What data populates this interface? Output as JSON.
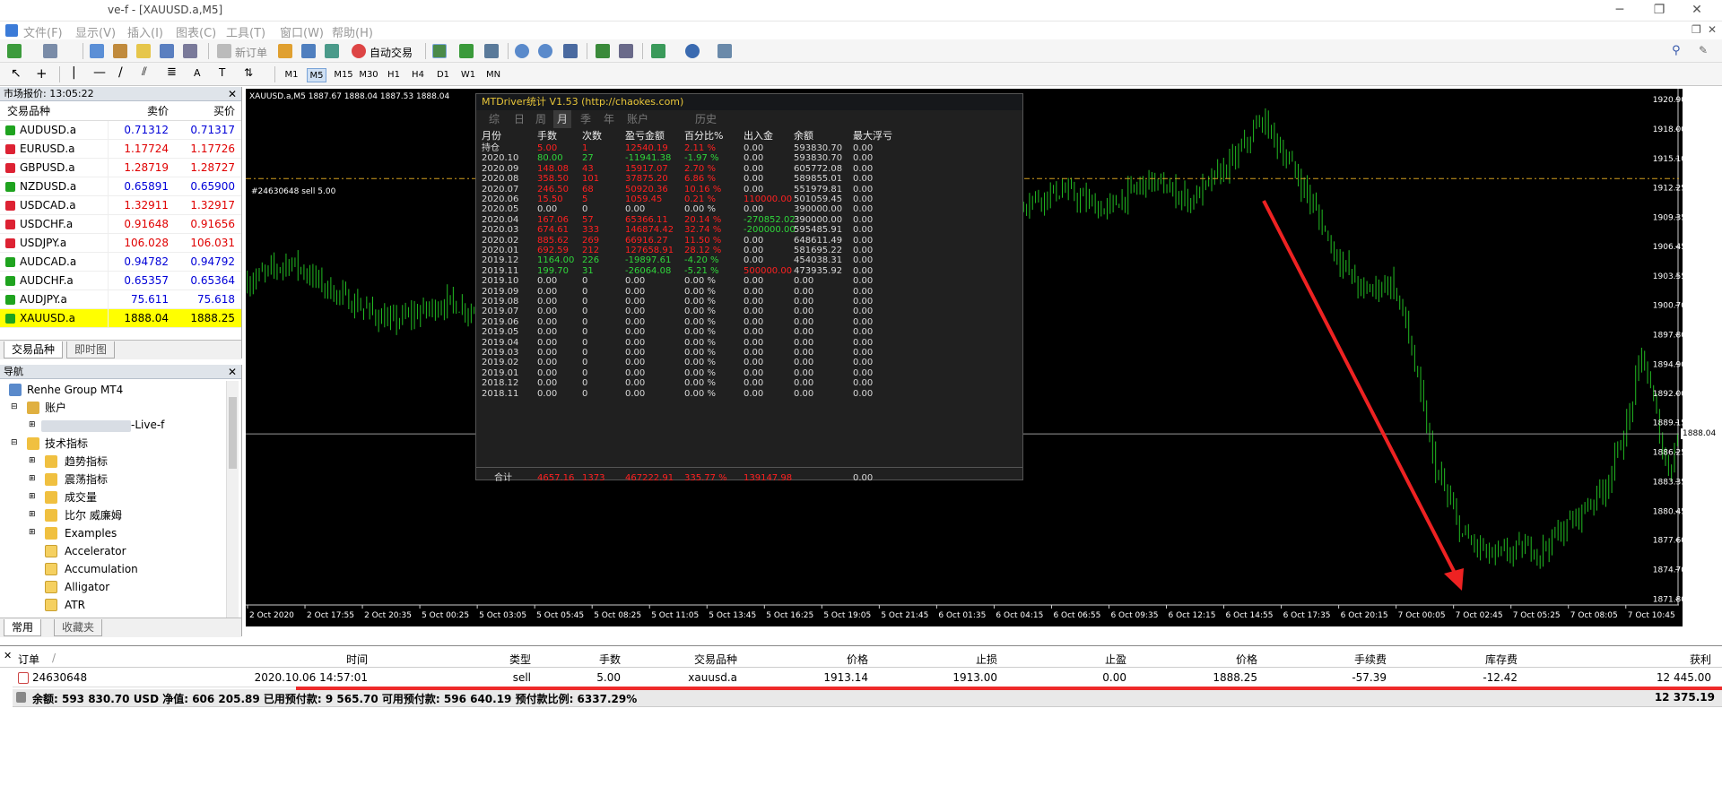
{
  "window": {
    "title": "ve-f - [XAUUSD.a,M5]"
  },
  "menu": [
    "文件(F)",
    "显示(V)",
    "插入(I)",
    "图表(C)",
    "工具(T)",
    "窗口(W)",
    "帮助(H)"
  ],
  "toolbar": {
    "new_order": "新订单",
    "auto_trade": "自动交易",
    "timeframes": [
      "M1",
      "M5",
      "M15",
      "M30",
      "H1",
      "H4",
      "D1",
      "W1",
      "MN"
    ],
    "active_tf": "M5"
  },
  "market_watch": {
    "title": "市场报价: 13:05:22",
    "col_symbol": "交易品种",
    "col_bid": "卖价",
    "col_ask": "买价",
    "rows": [
      {
        "s": "AUDUSD.a",
        "b": "0.71312",
        "a": "0.71317",
        "dir": "up",
        "bc": "blue",
        "ac": "blue"
      },
      {
        "s": "EURUSD.a",
        "b": "1.17724",
        "a": "1.17726",
        "dir": "dn",
        "bc": "red",
        "ac": "red"
      },
      {
        "s": "GBPUSD.a",
        "b": "1.28719",
        "a": "1.28727",
        "dir": "dn",
        "bc": "red",
        "ac": "red"
      },
      {
        "s": "NZDUSD.a",
        "b": "0.65891",
        "a": "0.65900",
        "dir": "up",
        "bc": "blue",
        "ac": "blue"
      },
      {
        "s": "USDCAD.a",
        "b": "1.32911",
        "a": "1.32917",
        "dir": "dn",
        "bc": "red",
        "ac": "red"
      },
      {
        "s": "USDCHF.a",
        "b": "0.91648",
        "a": "0.91656",
        "dir": "dn",
        "bc": "red",
        "ac": "red"
      },
      {
        "s": "USDJPY.a",
        "b": "106.028",
        "a": "106.031",
        "dir": "dn",
        "bc": "red",
        "ac": "red"
      },
      {
        "s": "AUDCAD.a",
        "b": "0.94782",
        "a": "0.94792",
        "dir": "up",
        "bc": "blue",
        "ac": "blue"
      },
      {
        "s": "AUDCHF.a",
        "b": "0.65357",
        "a": "0.65364",
        "dir": "up",
        "bc": "blue",
        "ac": "blue"
      },
      {
        "s": "AUDJPY.a",
        "b": "75.611",
        "a": "75.618",
        "dir": "up",
        "bc": "blue",
        "ac": "blue"
      },
      {
        "s": "XAUUSD.a",
        "b": "1888.04",
        "a": "1888.25",
        "dir": "up",
        "bc": "black",
        "ac": "black"
      }
    ],
    "tabs": [
      "交易品种",
      "即时图"
    ]
  },
  "navigator": {
    "title": "导航",
    "items": [
      "Renhe Group MT4",
      "账户",
      "-Live-f",
      "技术指标",
      "趋势指标",
      "震荡指标",
      "成交量",
      "比尔 威廉姆",
      "Examples",
      "Accelerator",
      "Accumulation",
      "Alligator",
      "ATR"
    ],
    "tabs": [
      "常用",
      "收藏夹"
    ]
  },
  "chart": {
    "header": "XAUUSD.a,M5  1887.67 1888.04 1887.53 1888.04",
    "order_line_label": "#24630648 sell 5.00",
    "current_price": "1888.04",
    "price_ticks": [
      "1920.90",
      "1918.00",
      "1915.10",
      "1912.25",
      "1909.35",
      "1906.45",
      "1903.55",
      "1900.70",
      "1897.80",
      "1894.90",
      "1892.00",
      "1889.15",
      "1886.25",
      "1883.35",
      "1880.45",
      "1877.60",
      "1874.70",
      "1871.80"
    ],
    "time_ticks": [
      "2 Oct 2020",
      "2 Oct 17:55",
      "2 Oct 20:35",
      "5 Oct 00:25",
      "5 Oct 03:05",
      "5 Oct 05:45",
      "5 Oct 08:25",
      "5 Oct 11:05",
      "5 Oct 13:45",
      "5 Oct 16:25",
      "5 Oct 19:05",
      "5 Oct 21:45",
      "6 Oct 01:35",
      "6 Oct 04:15",
      "6 Oct 06:55",
      "6 Oct 09:35",
      "6 Oct 12:15",
      "6 Oct 14:55",
      "6 Oct 17:35",
      "6 Oct 20:15",
      "7 Oct 00:05",
      "7 Oct 02:45",
      "7 Oct 05:25",
      "7 Oct 08:05",
      "7 Oct 10:45"
    ]
  },
  "mtdriver": {
    "title": "MTDriver统计 V1.53  (http://chaokes.com)",
    "tabs": [
      "综",
      "日",
      "周",
      "月",
      "季",
      "年",
      "账户",
      "历史"
    ],
    "active_tab": "月",
    "headers": [
      "月份",
      "手数",
      "次数",
      "盈亏金额",
      "百分比%",
      "出入金",
      "余额",
      "最大浮亏"
    ],
    "rows": [
      [
        "持仓",
        "5.00",
        "1",
        "12540.19",
        "2.11 %",
        "0.00",
        "593830.70",
        "0.00",
        "r"
      ],
      [
        "2020.10",
        "80.00",
        "27",
        "-11941.38",
        "-1.97 %",
        "0.00",
        "593830.70",
        "0.00",
        "g"
      ],
      [
        "2020.09",
        "148.08",
        "43",
        "15917.07",
        "2.70 %",
        "0.00",
        "605772.08",
        "0.00",
        "r"
      ],
      [
        "2020.08",
        "358.50",
        "101",
        "37875.20",
        "6.86 %",
        "0.00",
        "589855.01",
        "0.00",
        "r"
      ],
      [
        "2020.07",
        "246.50",
        "68",
        "50920.36",
        "10.16 %",
        "0.00",
        "551979.81",
        "0.00",
        "r"
      ],
      [
        "2020.06",
        "15.50",
        "5",
        "1059.45",
        "0.21 %",
        "110000.00",
        "501059.45",
        "0.00",
        "r"
      ],
      [
        "2020.05",
        "0.00",
        "0",
        "0.00",
        "0.00 %",
        "0.00",
        "390000.00",
        "0.00",
        "w"
      ],
      [
        "2020.04",
        "167.06",
        "57",
        "65366.11",
        "20.14 %",
        "-270852.02",
        "390000.00",
        "0.00",
        "r"
      ],
      [
        "2020.03",
        "674.61",
        "333",
        "146874.42",
        "32.74 %",
        "-200000.00",
        "595485.91",
        "0.00",
        "r"
      ],
      [
        "2020.02",
        "885.62",
        "269",
        "66916.27",
        "11.50 %",
        "0.00",
        "648611.49",
        "0.00",
        "r"
      ],
      [
        "2020.01",
        "692.59",
        "212",
        "127658.91",
        "28.12 %",
        "0.00",
        "581695.22",
        "0.00",
        "r"
      ],
      [
        "2019.12",
        "1164.00",
        "226",
        "-19897.61",
        "-4.20 %",
        "0.00",
        "454038.31",
        "0.00",
        "g"
      ],
      [
        "2019.11",
        "199.70",
        "31",
        "-26064.08",
        "-5.21 %",
        "500000.00",
        "473935.92",
        "0.00",
        "g"
      ],
      [
        "2019.10",
        "0.00",
        "0",
        "0.00",
        "0.00 %",
        "0.00",
        "0.00",
        "0.00",
        "w"
      ],
      [
        "2019.09",
        "0.00",
        "0",
        "0.00",
        "0.00 %",
        "0.00",
        "0.00",
        "0.00",
        "w"
      ],
      [
        "2019.08",
        "0.00",
        "0",
        "0.00",
        "0.00 %",
        "0.00",
        "0.00",
        "0.00",
        "w"
      ],
      [
        "2019.07",
        "0.00",
        "0",
        "0.00",
        "0.00 %",
        "0.00",
        "0.00",
        "0.00",
        "w"
      ],
      [
        "2019.06",
        "0.00",
        "0",
        "0.00",
        "0.00 %",
        "0.00",
        "0.00",
        "0.00",
        "w"
      ],
      [
        "2019.05",
        "0.00",
        "0",
        "0.00",
        "0.00 %",
        "0.00",
        "0.00",
        "0.00",
        "w"
      ],
      [
        "2019.04",
        "0.00",
        "0",
        "0.00",
        "0.00 %",
        "0.00",
        "0.00",
        "0.00",
        "w"
      ],
      [
        "2019.03",
        "0.00",
        "0",
        "0.00",
        "0.00 %",
        "0.00",
        "0.00",
        "0.00",
        "w"
      ],
      [
        "2019.02",
        "0.00",
        "0",
        "0.00",
        "0.00 %",
        "0.00",
        "0.00",
        "0.00",
        "w"
      ],
      [
        "2019.01",
        "0.00",
        "0",
        "0.00",
        "0.00 %",
        "0.00",
        "0.00",
        "0.00",
        "w"
      ],
      [
        "2018.12",
        "0.00",
        "0",
        "0.00",
        "0.00 %",
        "0.00",
        "0.00",
        "0.00",
        "w"
      ],
      [
        "2018.11",
        "0.00",
        "0",
        "0.00",
        "0.00 %",
        "0.00",
        "0.00",
        "0.00",
        "w"
      ]
    ],
    "total": [
      "合计",
      "4657.16",
      "1373",
      "467222.91",
      "335.77 %",
      "139147.98",
      "",
      "0.00"
    ]
  },
  "terminal": {
    "headers": [
      "订单",
      "时间",
      "类型",
      "手数",
      "交易品种",
      "价格",
      "止损",
      "止盈",
      "价格",
      "手续费",
      "库存费",
      "获利"
    ],
    "order": [
      "24630648",
      "2020.10.06 14:57:01",
      "sell",
      "5.00",
      "xauusd.a",
      "1913.14",
      "1913.00",
      "0.00",
      "1888.25",
      "-57.39",
      "-12.42",
      "12 445.00"
    ],
    "summary": "余额: 593 830.70 USD  净值: 606 205.89  已用预付款: 9 565.70  可用预付款: 596 640.19  预付款比例: 6337.29%",
    "summary_profit": "12 375.19"
  },
  "colors": {
    "bull": "#22bb22",
    "bear": "#ff2020",
    "accent": "#e8c63a",
    "highlight": "#ffff00"
  }
}
